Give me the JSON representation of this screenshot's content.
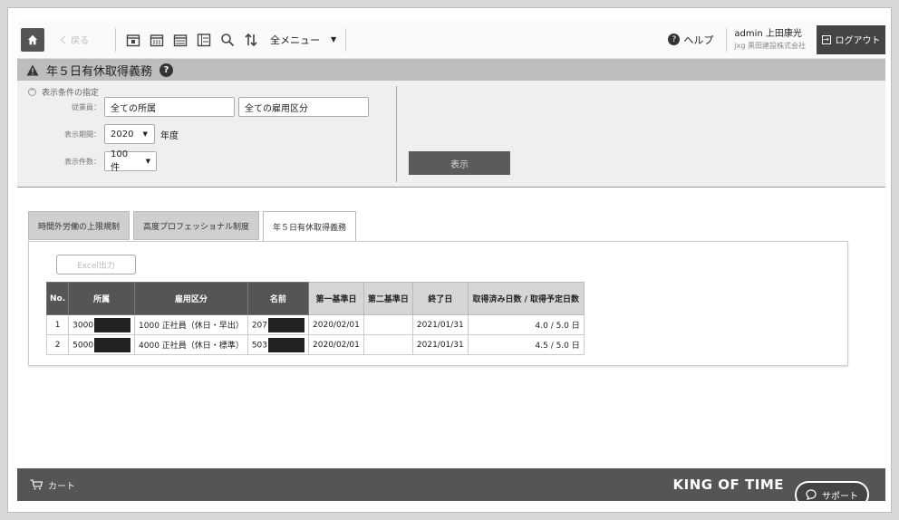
{
  "topbar": {
    "back_label": "く 戻る",
    "menu_label": "全メニュー",
    "help_label": "ヘルプ",
    "user_name": "admin 上田康光",
    "company": "jxg 黒田建設株式会社",
    "logout_label": "ログアウト"
  },
  "page": {
    "title": "年５日有休取得義務"
  },
  "conditions": {
    "header": "表示条件の指定",
    "employee_label": "従業員：",
    "department_value": "全ての所属",
    "employment_value": "全ての雇用区分",
    "period_label": "表示期間：",
    "year_value": "2020",
    "year_unit": "年度",
    "count_label": "表示件数：",
    "count_value": "100件",
    "show_button": "表示"
  },
  "tabs": [
    {
      "label": "時間外労働の上限規制"
    },
    {
      "label": "高度プロフェッショナル制度"
    },
    {
      "label": "年５日有休取得義務"
    }
  ],
  "table": {
    "excel_button": "Excel出力",
    "headers": [
      "No.",
      "所属",
      "雇用区分",
      "名前",
      "第一基準日",
      "第二基準日",
      "終了日",
      "取得済み日数 / 取得予定日数"
    ],
    "rows": [
      {
        "no": "1",
        "dept": "3000",
        "employment": "1000 正社員（休日・早出）",
        "name": "207",
        "first": "2020/02/01",
        "second": "",
        "end": "2021/01/31",
        "days": "4.0 / 5.0 日"
      },
      {
        "no": "2",
        "dept": "5000",
        "employment": "4000 正社員（休日・標準）",
        "name": "503",
        "first": "2020/02/01",
        "second": "",
        "end": "2021/01/31",
        "days": "4.5 / 5.0 日"
      }
    ]
  },
  "footer": {
    "cart_label": "カート",
    "logo_text": "KING OF TIME",
    "support_label": "サポート"
  }
}
